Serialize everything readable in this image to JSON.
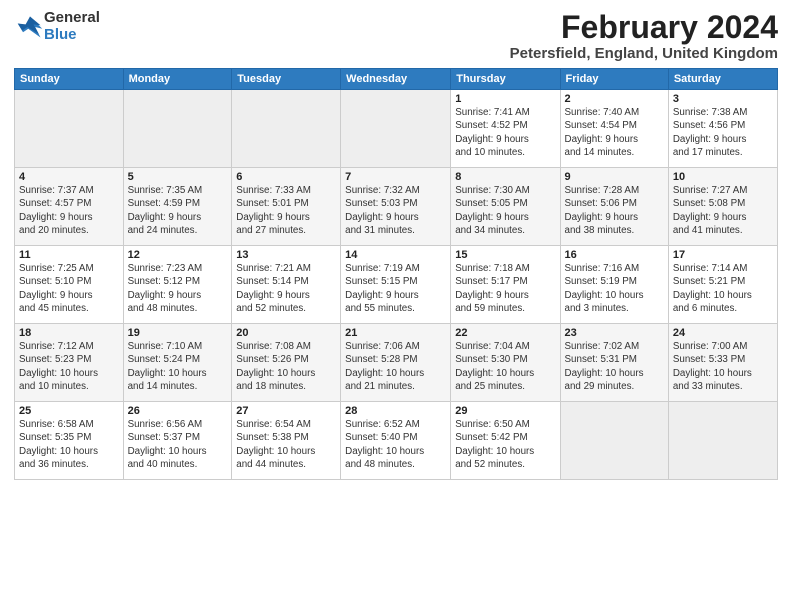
{
  "logo": {
    "general": "General",
    "blue": "Blue"
  },
  "header": {
    "title": "February 2024",
    "subtitle": "Petersfield, England, United Kingdom"
  },
  "days_of_week": [
    "Sunday",
    "Monday",
    "Tuesday",
    "Wednesday",
    "Thursday",
    "Friday",
    "Saturday"
  ],
  "weeks": [
    [
      {
        "day": "",
        "info": ""
      },
      {
        "day": "",
        "info": ""
      },
      {
        "day": "",
        "info": ""
      },
      {
        "day": "",
        "info": ""
      },
      {
        "day": "1",
        "info": "Sunrise: 7:41 AM\nSunset: 4:52 PM\nDaylight: 9 hours\nand 10 minutes."
      },
      {
        "day": "2",
        "info": "Sunrise: 7:40 AM\nSunset: 4:54 PM\nDaylight: 9 hours\nand 14 minutes."
      },
      {
        "day": "3",
        "info": "Sunrise: 7:38 AM\nSunset: 4:56 PM\nDaylight: 9 hours\nand 17 minutes."
      }
    ],
    [
      {
        "day": "4",
        "info": "Sunrise: 7:37 AM\nSunset: 4:57 PM\nDaylight: 9 hours\nand 20 minutes."
      },
      {
        "day": "5",
        "info": "Sunrise: 7:35 AM\nSunset: 4:59 PM\nDaylight: 9 hours\nand 24 minutes."
      },
      {
        "day": "6",
        "info": "Sunrise: 7:33 AM\nSunset: 5:01 PM\nDaylight: 9 hours\nand 27 minutes."
      },
      {
        "day": "7",
        "info": "Sunrise: 7:32 AM\nSunset: 5:03 PM\nDaylight: 9 hours\nand 31 minutes."
      },
      {
        "day": "8",
        "info": "Sunrise: 7:30 AM\nSunset: 5:05 PM\nDaylight: 9 hours\nand 34 minutes."
      },
      {
        "day": "9",
        "info": "Sunrise: 7:28 AM\nSunset: 5:06 PM\nDaylight: 9 hours\nand 38 minutes."
      },
      {
        "day": "10",
        "info": "Sunrise: 7:27 AM\nSunset: 5:08 PM\nDaylight: 9 hours\nand 41 minutes."
      }
    ],
    [
      {
        "day": "11",
        "info": "Sunrise: 7:25 AM\nSunset: 5:10 PM\nDaylight: 9 hours\nand 45 minutes."
      },
      {
        "day": "12",
        "info": "Sunrise: 7:23 AM\nSunset: 5:12 PM\nDaylight: 9 hours\nand 48 minutes."
      },
      {
        "day": "13",
        "info": "Sunrise: 7:21 AM\nSunset: 5:14 PM\nDaylight: 9 hours\nand 52 minutes."
      },
      {
        "day": "14",
        "info": "Sunrise: 7:19 AM\nSunset: 5:15 PM\nDaylight: 9 hours\nand 55 minutes."
      },
      {
        "day": "15",
        "info": "Sunrise: 7:18 AM\nSunset: 5:17 PM\nDaylight: 9 hours\nand 59 minutes."
      },
      {
        "day": "16",
        "info": "Sunrise: 7:16 AM\nSunset: 5:19 PM\nDaylight: 10 hours\nand 3 minutes."
      },
      {
        "day": "17",
        "info": "Sunrise: 7:14 AM\nSunset: 5:21 PM\nDaylight: 10 hours\nand 6 minutes."
      }
    ],
    [
      {
        "day": "18",
        "info": "Sunrise: 7:12 AM\nSunset: 5:23 PM\nDaylight: 10 hours\nand 10 minutes."
      },
      {
        "day": "19",
        "info": "Sunrise: 7:10 AM\nSunset: 5:24 PM\nDaylight: 10 hours\nand 14 minutes."
      },
      {
        "day": "20",
        "info": "Sunrise: 7:08 AM\nSunset: 5:26 PM\nDaylight: 10 hours\nand 18 minutes."
      },
      {
        "day": "21",
        "info": "Sunrise: 7:06 AM\nSunset: 5:28 PM\nDaylight: 10 hours\nand 21 minutes."
      },
      {
        "day": "22",
        "info": "Sunrise: 7:04 AM\nSunset: 5:30 PM\nDaylight: 10 hours\nand 25 minutes."
      },
      {
        "day": "23",
        "info": "Sunrise: 7:02 AM\nSunset: 5:31 PM\nDaylight: 10 hours\nand 29 minutes."
      },
      {
        "day": "24",
        "info": "Sunrise: 7:00 AM\nSunset: 5:33 PM\nDaylight: 10 hours\nand 33 minutes."
      }
    ],
    [
      {
        "day": "25",
        "info": "Sunrise: 6:58 AM\nSunset: 5:35 PM\nDaylight: 10 hours\nand 36 minutes."
      },
      {
        "day": "26",
        "info": "Sunrise: 6:56 AM\nSunset: 5:37 PM\nDaylight: 10 hours\nand 40 minutes."
      },
      {
        "day": "27",
        "info": "Sunrise: 6:54 AM\nSunset: 5:38 PM\nDaylight: 10 hours\nand 44 minutes."
      },
      {
        "day": "28",
        "info": "Sunrise: 6:52 AM\nSunset: 5:40 PM\nDaylight: 10 hours\nand 48 minutes."
      },
      {
        "day": "29",
        "info": "Sunrise: 6:50 AM\nSunset: 5:42 PM\nDaylight: 10 hours\nand 52 minutes."
      },
      {
        "day": "",
        "info": ""
      },
      {
        "day": "",
        "info": ""
      }
    ]
  ]
}
